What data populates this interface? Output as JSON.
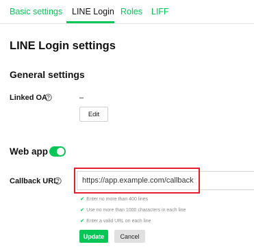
{
  "tabs": [
    {
      "label": "Basic settings",
      "active": false
    },
    {
      "label": "LINE Login",
      "active": true
    },
    {
      "label": "Roles",
      "active": false
    },
    {
      "label": "LIFF",
      "active": false
    }
  ],
  "page_title": "LINE Login settings",
  "general": {
    "title": "General settings",
    "linked_oa": {
      "label": "Linked OA",
      "value": "–",
      "edit_label": "Edit"
    }
  },
  "web_app": {
    "label": "Web app",
    "enabled": true
  },
  "callback": {
    "label": "Callback URL",
    "value": "https://app.example.com/callback",
    "rules": [
      "Enter no more than 400 lines",
      "Use no more than 1000 characters in each line",
      "Enter a valid URL on each line"
    ],
    "update_label": "Update",
    "cancel_label": "Cancel"
  },
  "icons": {
    "help": "question-circle-icon",
    "check": "check-icon"
  },
  "colors": {
    "brand_green": "#06c755",
    "highlight_red": "#e11d2a",
    "muted_text": "#8a8a8a"
  }
}
